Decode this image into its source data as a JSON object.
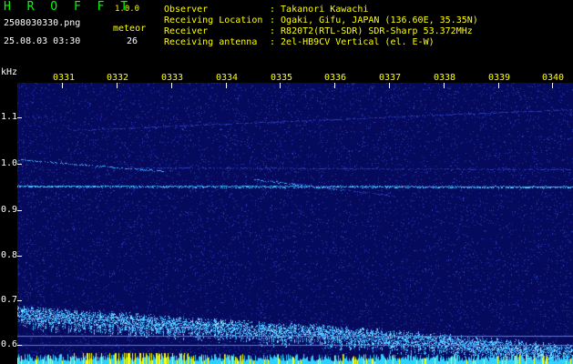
{
  "header": {
    "app_title": "H R O F F T",
    "version": "1.0.0",
    "filename": "2508030330.png",
    "meteor_label": "meteor",
    "datetime": "25.08.03 03:30",
    "meteor_count": "26",
    "info": [
      {
        "label": "Observer",
        "value": ": Takanori Kawachi"
      },
      {
        "label": "Receiving Location",
        "value": ": Ogaki, Gifu, JAPAN (136.60E, 35.35N)"
      },
      {
        "label": "Receiver",
        "value": ": R820T2(RTL-SDR) SDR-Sharp 53.372MHz"
      },
      {
        "label": "Receiving antenna",
        "value": ": 2el-HB9CV Vertical (el. E-W)"
      }
    ]
  },
  "spectrogram": {
    "y_unit": "kHz",
    "time_labels": [
      "0331",
      "0332",
      "0333",
      "0334",
      "0335",
      "0336",
      "0337",
      "0338",
      "0339",
      "0340"
    ],
    "freq_labels": [
      "1.1",
      "1.0",
      "0.9",
      "0.8",
      "0.7",
      "0.6"
    ],
    "colors": {
      "background": "#060a5c",
      "noise": "#2b3dbd",
      "signal": "#39b6ff",
      "hot": "#ffff00",
      "label_time": "#ffff00",
      "label_freq": "#ffffff"
    }
  }
}
